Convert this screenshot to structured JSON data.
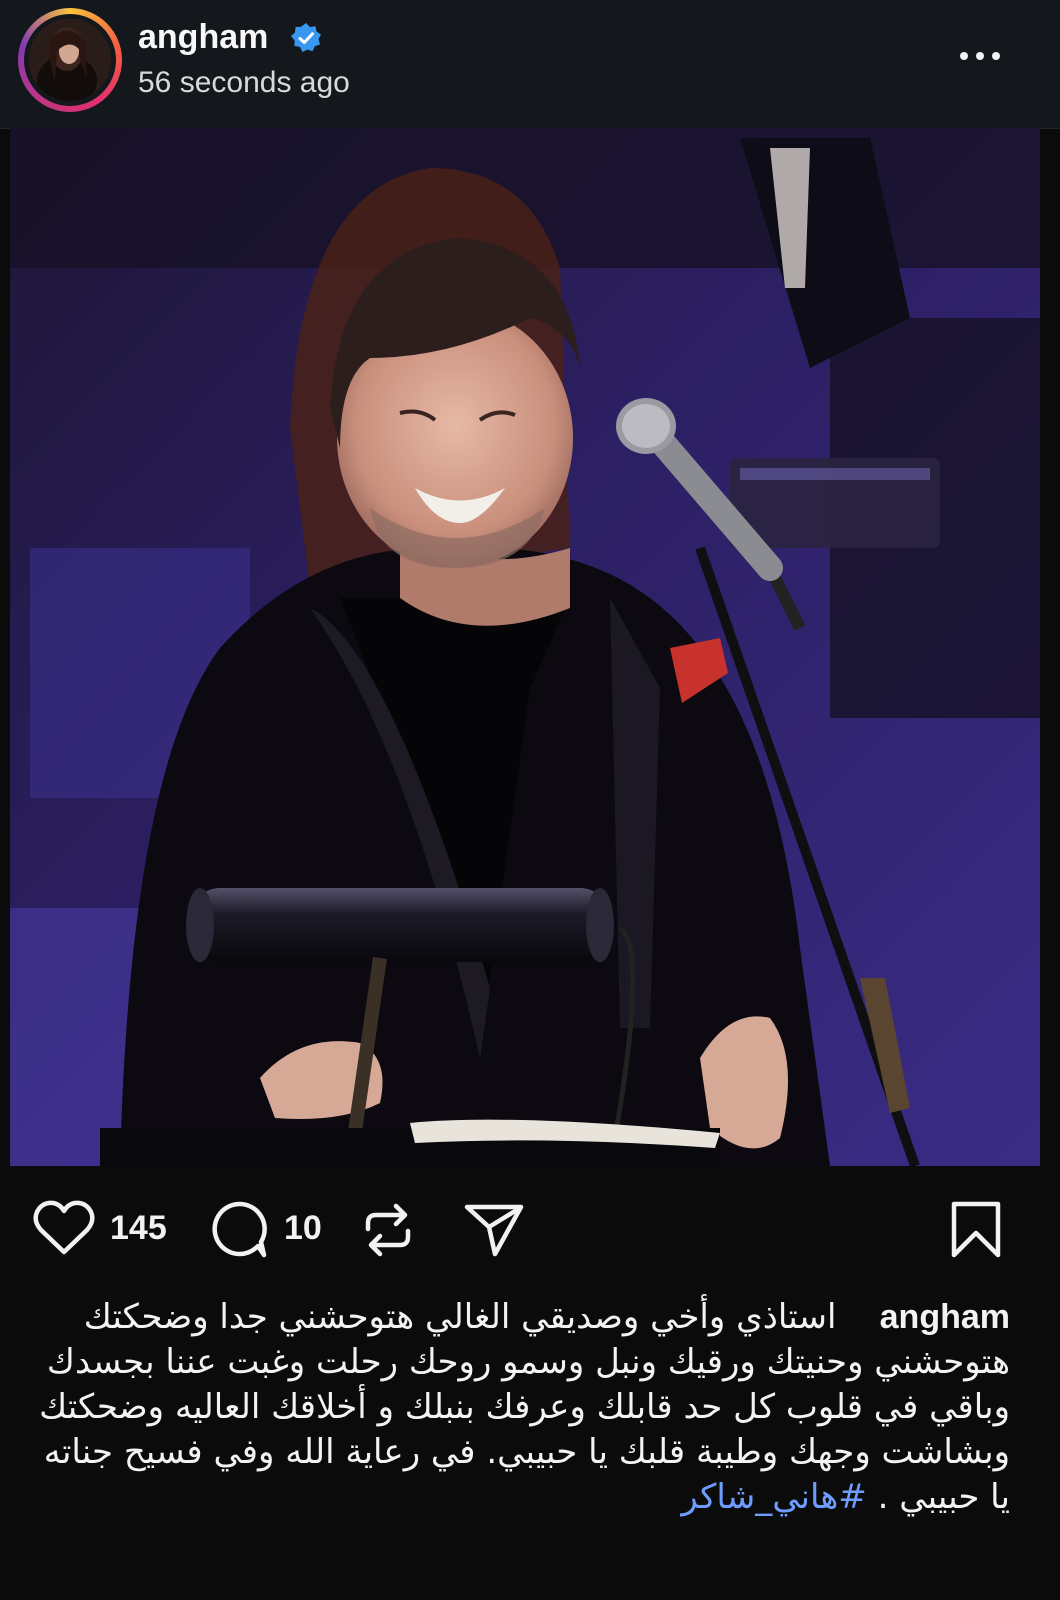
{
  "post": {
    "username": "angham",
    "timestamp": "56 seconds ago",
    "verified": true,
    "avatar_icon": "profile-photo",
    "more_icon": "ellipsis-icon"
  },
  "photo": {
    "icon": "concert-photo"
  },
  "actions": {
    "likes": "145",
    "comments": "10",
    "icons": [
      "heart-icon",
      "comment-icon",
      "repost-icon",
      "share-icon",
      "bookmark-icon"
    ]
  },
  "caption": {
    "username": "angham",
    "text": "استاذي وأخي وصديقي الغالي هتوحشني جدا وضحكتك هتوحشني وحنيتك ورقيك ونبل وسمو روحك  رحلت وغبت عننا بجسدك وباقي في قلوب كل  حد قابلك وعرفك بنبلك و أخلاقك العاليه وضحكتك وبشاشت وجهك وطيبة قلبك يا حبيبي. في رعاية الله وفي فسيح جناته يا حبيبي .",
    "hashtag": "#هاني_شاكر"
  },
  "colors": {
    "background": "#0b0b0b",
    "header": "#14181c",
    "verified_blue": "#3897f0",
    "hashtag": "#6f9cff"
  }
}
